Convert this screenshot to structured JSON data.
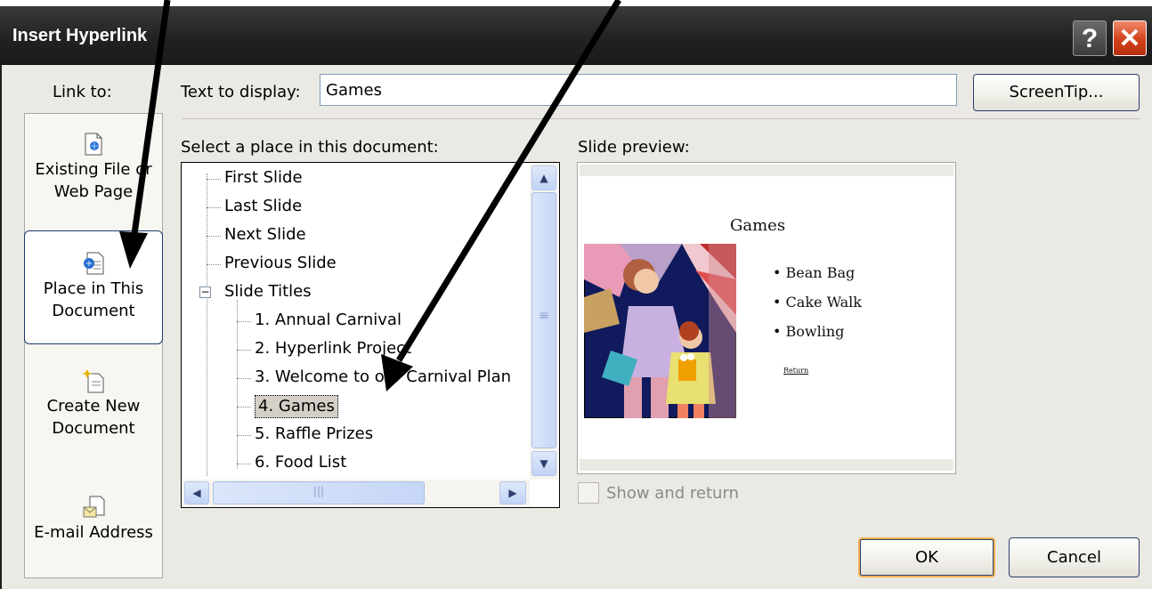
{
  "dialog": {
    "title": "Insert Hyperlink",
    "help_glyph": "?",
    "close_glyph": "✕"
  },
  "link_to": {
    "label": "Link to:",
    "items": [
      {
        "line1": "Existing File or",
        "line2": "Web Page",
        "icon": "existing-file-icon"
      },
      {
        "line1": "Place in This",
        "line2": "Document",
        "icon": "place-in-document-icon",
        "selected": true
      },
      {
        "line1": "Create New",
        "line2": "Document",
        "icon": "new-document-icon"
      },
      {
        "line1": "E-mail Address",
        "line2": "",
        "icon": "email-address-icon"
      }
    ]
  },
  "text_to_display": {
    "label": "Text to display:",
    "value": "Games"
  },
  "screentip_button": "ScreenTip...",
  "place_list": {
    "label": "Select a place in this document:",
    "items": [
      "First Slide",
      "Last Slide",
      "Next Slide",
      "Previous Slide",
      "Slide Titles",
      "1. Annual Carnival",
      "2. Hyperlink Project",
      "3. Welcome to our Carnival Plan",
      "4. Games",
      "5. Raffle Prizes",
      "6. Food List"
    ],
    "expander": "−",
    "selected": "4. Games"
  },
  "slide_preview": {
    "label": "Slide preview:",
    "slide_title": "Games",
    "bullets": [
      "Bean Bag",
      "Cake Walk",
      "Bowling"
    ],
    "bullet_char": "•",
    "link_text": "Return"
  },
  "show_and_return": {
    "label": "Show and return",
    "checked": false
  },
  "ok_button": "OK",
  "cancel_button": "Cancel",
  "scroll_glyphs": {
    "up": "▲",
    "down": "▼",
    "left": "◀",
    "right": "▶",
    "grip": "≡",
    "hgrip": "|||"
  },
  "colors": {
    "title_bar": "#222222",
    "close_button": "#d2401a",
    "selection_outline": "#1e3a6b",
    "dialog_face": "#ebe9e3",
    "ok_border_accent": "#f0b050"
  }
}
